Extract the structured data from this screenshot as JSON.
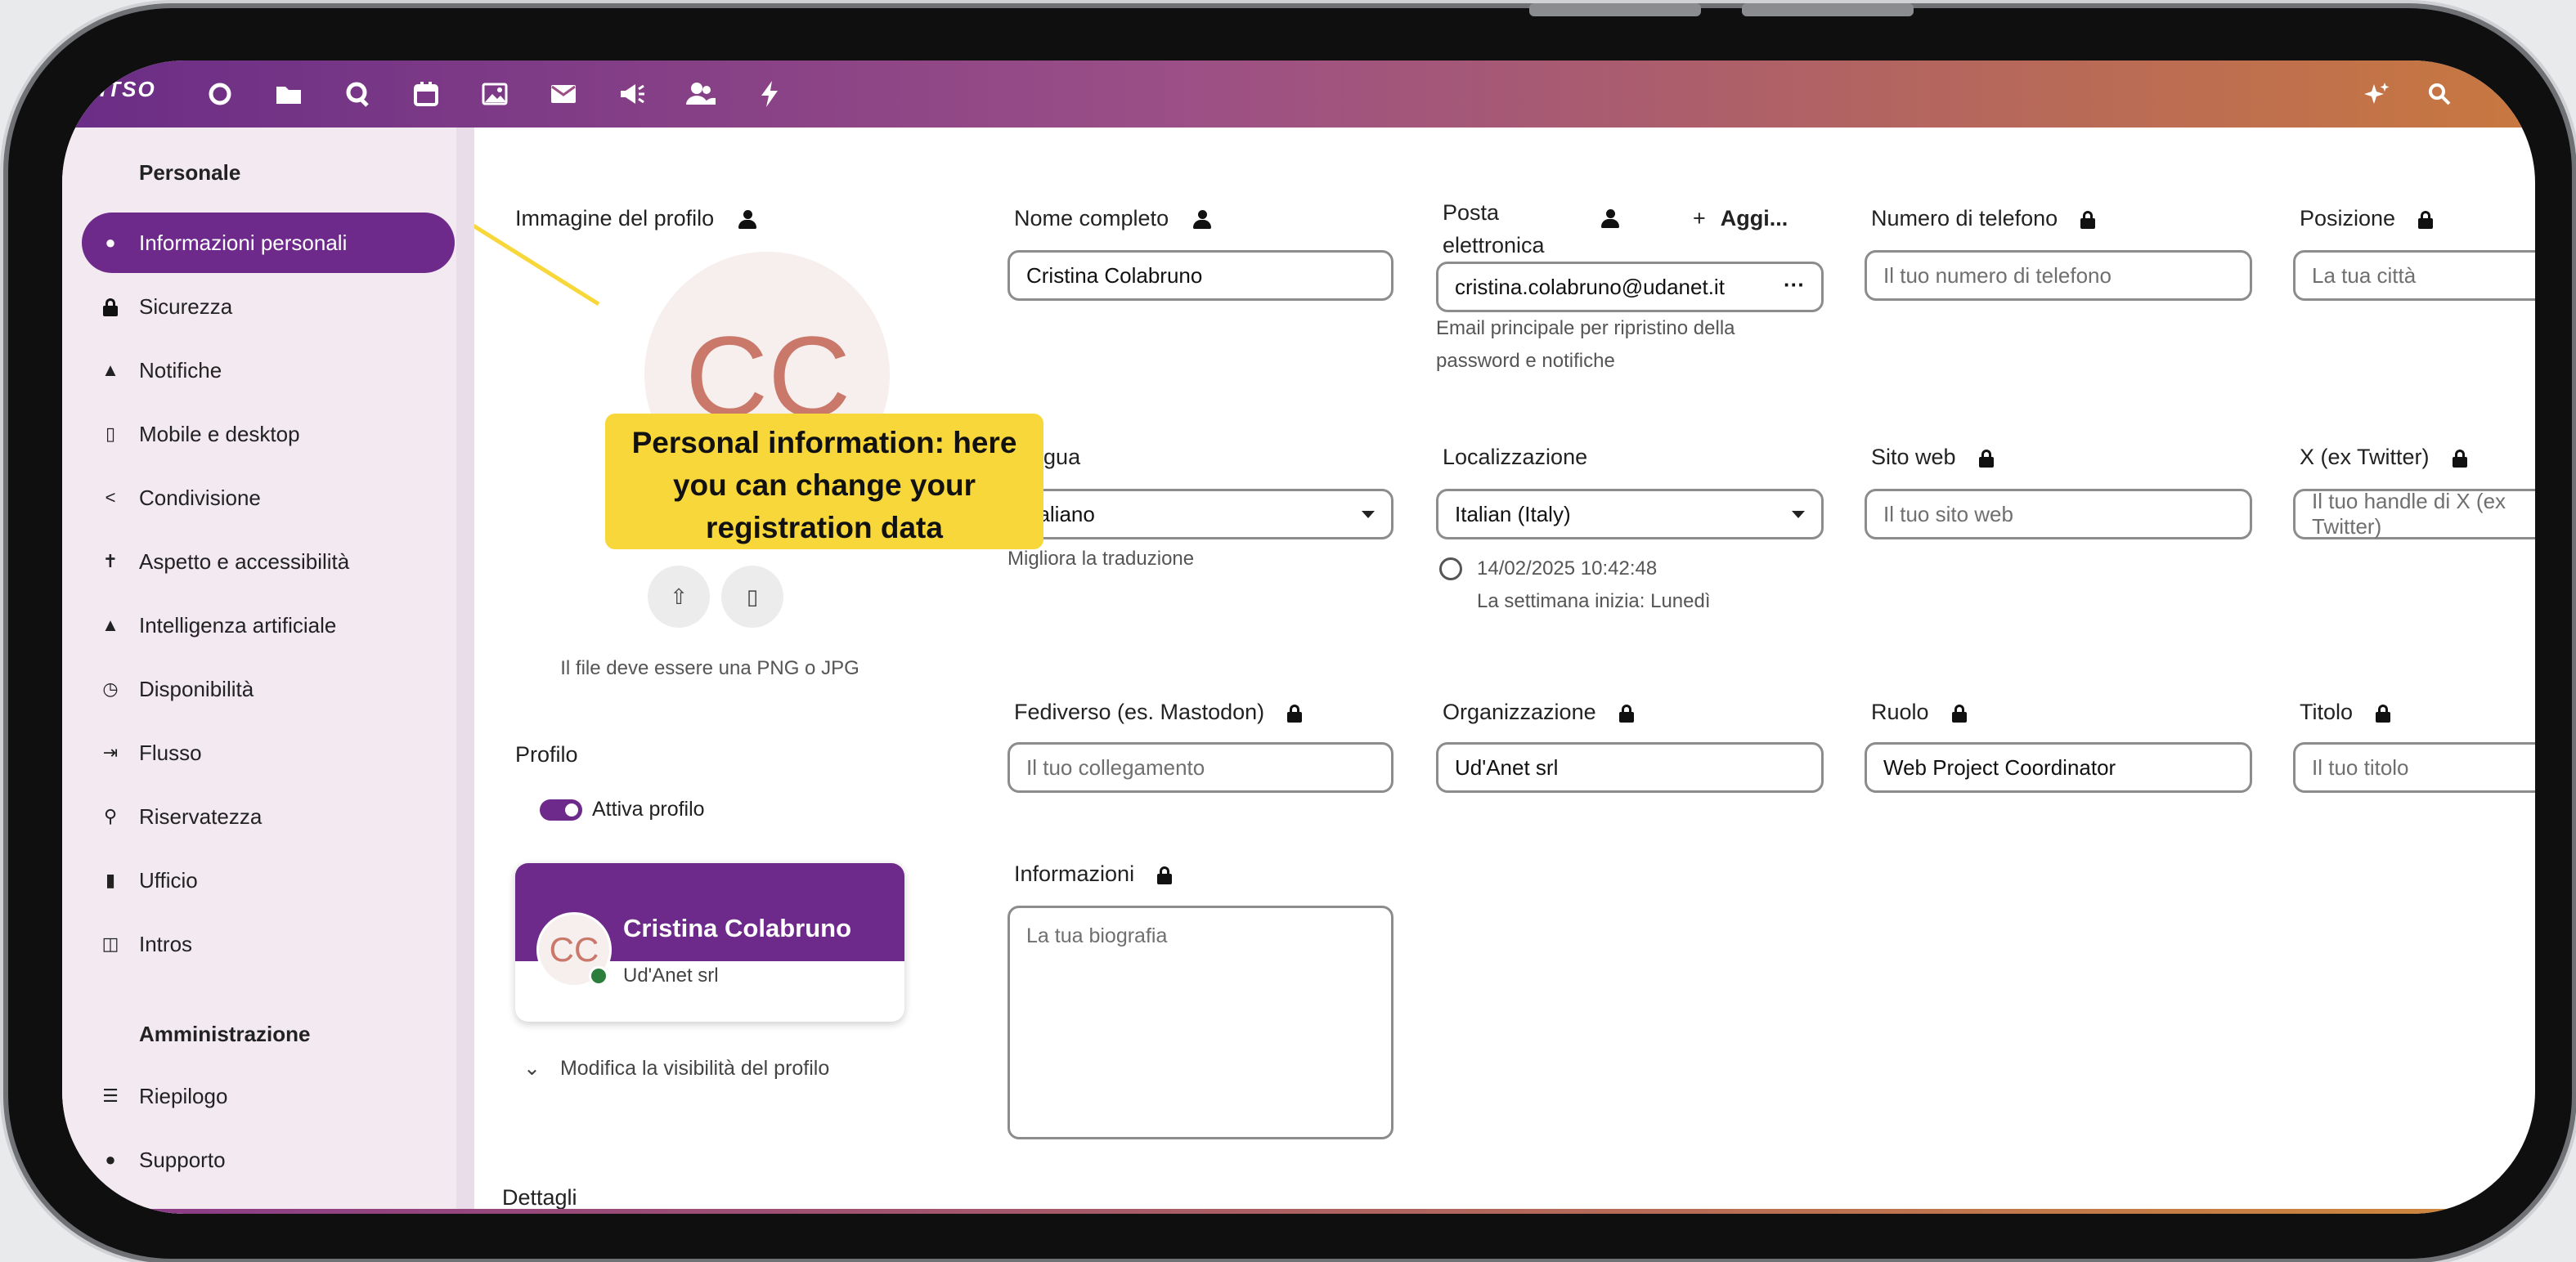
{
  "topbar": {
    "logo_text": "ITSO",
    "apps": [
      "dashboard-icon",
      "files-icon",
      "talk-icon",
      "calendar-icon",
      "photos-icon",
      "mail-icon",
      "announcements-icon",
      "contacts-icon",
      "activity-icon"
    ],
    "right_icons": [
      "assistant-icon",
      "search-icon"
    ]
  },
  "sidebar": {
    "section_personal": "Personale",
    "items": [
      {
        "label": "Informazioni personali",
        "icon": "person-icon",
        "active": true
      },
      {
        "label": "Sicurezza",
        "icon": "lock-icon"
      },
      {
        "label": "Notifiche",
        "icon": "bell-icon"
      },
      {
        "label": "Mobile e desktop",
        "icon": "mobile-icon"
      },
      {
        "label": "Condivisione",
        "icon": "share-icon"
      },
      {
        "label": "Aspetto e accessibilità",
        "icon": "accessibility-icon"
      },
      {
        "label": "Intelligenza artificiale",
        "icon": "ai-icon"
      },
      {
        "label": "Disponibilità",
        "icon": "clock-icon"
      },
      {
        "label": "Flusso",
        "icon": "flow-icon"
      },
      {
        "label": "Riservatezza",
        "icon": "key-icon"
      },
      {
        "label": "Ufficio",
        "icon": "document-icon"
      },
      {
        "label": "Intros",
        "icon": "intros-icon"
      }
    ],
    "section_admin": "Amministrazione",
    "admin_items": [
      {
        "label": "Riepilogo",
        "icon": "list-icon"
      },
      {
        "label": "Supporto",
        "icon": "support-icon"
      }
    ]
  },
  "profile_image": {
    "label": "Immagine del profilo",
    "initials": "CC",
    "hint": "Il file deve essere una PNG o JPG"
  },
  "profile": {
    "label": "Profilo",
    "toggle_label": "Attiva profilo",
    "card_name": "Cristina Colabruno",
    "card_org": "Ud'Anet srl",
    "card_initials": "CC",
    "visibility_link": "Modifica la visibilità del profilo"
  },
  "fields": {
    "full_name": {
      "label": "Nome completo",
      "value": "Cristina Colabruno"
    },
    "email": {
      "label_line1": "Posta",
      "label_line2": "elettronica",
      "add_label": "Aggi...",
      "value": "cristina.colabruno@udanet.it",
      "hint": "Email principale per ripristino della password e notifiche"
    },
    "phone": {
      "label": "Numero di telefono",
      "placeholder": "Il tuo numero di telefono"
    },
    "position": {
      "label": "Posizione",
      "placeholder": "La tua città"
    },
    "language": {
      "label": "Lingua",
      "value": "Italiano",
      "hint": "Migliora la traduzione"
    },
    "locale": {
      "label": "Localizzazione",
      "value": "Italian (Italy)",
      "datetime": "14/02/2025 10:42:48",
      "week_start": "La settimana inizia: Lunedì"
    },
    "website": {
      "label": "Sito web",
      "placeholder": "Il tuo sito web"
    },
    "twitter": {
      "label": "X (ex Twitter)",
      "placeholder": "Il tuo handle di X (ex Twitter)"
    },
    "fediverse": {
      "label": "Fediverso (es. Mastodon)",
      "placeholder": "Il tuo collegamento"
    },
    "organisation": {
      "label": "Organizzazione",
      "value": "Ud'Anet srl"
    },
    "role": {
      "label": "Ruolo",
      "value": "Web Project Coordinator"
    },
    "title": {
      "label": "Titolo",
      "placeholder": "Il tuo titolo"
    },
    "bio": {
      "label": "Informazioni",
      "placeholder": "La tua biografia"
    }
  },
  "details_heading": "Dettagli",
  "callout": {
    "line1": "Personal information: here",
    "line2": "you can change your",
    "line3": "registration data"
  },
  "colors": {
    "accent": "#6e2a8b",
    "callout": "#f7d73a",
    "status_online": "#2c7e3c"
  }
}
